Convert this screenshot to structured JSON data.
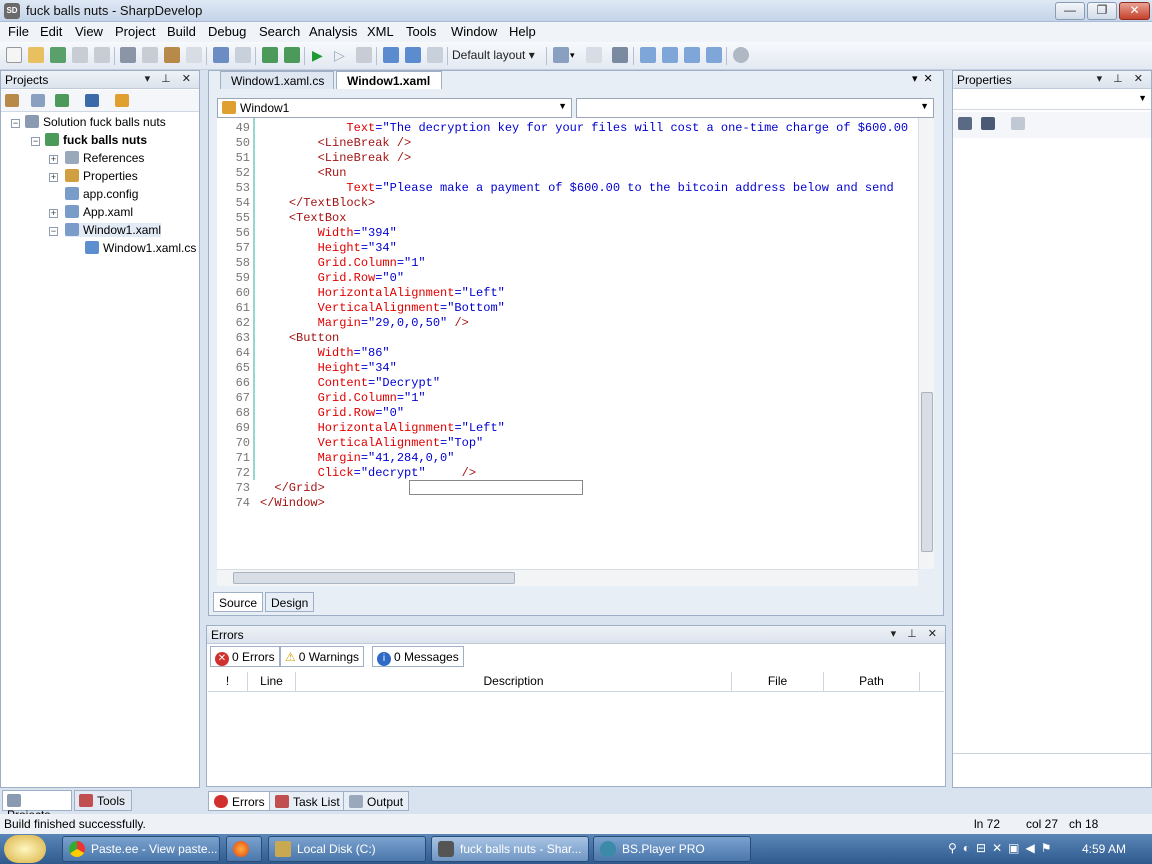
{
  "window": {
    "title": "fuck balls nuts - SharpDevelop",
    "app_icon": "SD"
  },
  "menu": [
    "File",
    "Edit",
    "View",
    "Project",
    "Build",
    "Debug",
    "Search",
    "Analysis",
    "XML",
    "Tools",
    "Window",
    "Help"
  ],
  "toolbar": {
    "layout": "Default layout"
  },
  "projects_panel": {
    "title": "Projects",
    "tree": {
      "solution": "Solution fuck balls nuts",
      "project": "fuck balls nuts",
      "items": [
        "References",
        "Properties",
        "app.config",
        "App.xaml",
        "Window1.xaml"
      ],
      "child": "Window1.xaml.cs"
    },
    "tabs": [
      "Projects",
      "Tools"
    ]
  },
  "editor": {
    "tabs": [
      "Window1.xaml.cs",
      "Window1.xaml"
    ],
    "combo_left": "Window1",
    "combo_right": "",
    "lines": [
      {
        "n": "49",
        "code": "            Text=\"The decryption key for your files will cost a one-time charge of $600.00"
      },
      {
        "n": "50",
        "code": "        <LineBreak />"
      },
      {
        "n": "51",
        "code": "        <LineBreak />"
      },
      {
        "n": "52",
        "code": "        <Run"
      },
      {
        "n": "53",
        "code": "            Text=\"Please make a payment of $600.00 to the bitcoin address below and send"
      },
      {
        "n": "54",
        "code": "    </TextBlock>"
      },
      {
        "n": "55",
        "code": "    <TextBox"
      },
      {
        "n": "56",
        "code": "        Width=\"394\""
      },
      {
        "n": "57",
        "code": "        Height=\"34\""
      },
      {
        "n": "58",
        "code": "        Grid.Column=\"1\""
      },
      {
        "n": "59",
        "code": "        Grid.Row=\"0\""
      },
      {
        "n": "60",
        "code": "        HorizontalAlignment=\"Left\""
      },
      {
        "n": "61",
        "code": "        VerticalAlignment=\"Bottom\""
      },
      {
        "n": "62",
        "code": "        Margin=\"29,0,0,50\" />"
      },
      {
        "n": "63",
        "code": "    <Button"
      },
      {
        "n": "64",
        "code": "        Width=\"86\""
      },
      {
        "n": "65",
        "code": "        Height=\"34\""
      },
      {
        "n": "66",
        "code": "        Content=\"Decrypt\""
      },
      {
        "n": "67",
        "code": "        Grid.Column=\"1\""
      },
      {
        "n": "68",
        "code": "        Grid.Row=\"0\""
      },
      {
        "n": "69",
        "code": "        HorizontalAlignment=\"Left\""
      },
      {
        "n": "70",
        "code": "        VerticalAlignment=\"Top\""
      },
      {
        "n": "71",
        "code": "        Margin=\"41,284,0,0\""
      },
      {
        "n": "72",
        "code": "        Click=\"decrypt\"     />"
      },
      {
        "n": "73",
        "code": "  </Grid>"
      },
      {
        "n": "74",
        "code": "</Window>"
      }
    ],
    "bottom_tabs": [
      "Source",
      "Design"
    ]
  },
  "properties_panel": {
    "title": "Properties"
  },
  "errors_panel": {
    "title": "Errors",
    "buttons": [
      "0 Errors",
      "0 Warnings",
      "0 Messages"
    ],
    "columns": [
      "!",
      "Line",
      "Description",
      "File",
      "Path"
    ],
    "tabs": [
      "Errors",
      "Task List",
      "Output"
    ]
  },
  "status": {
    "message": "Build finished successfully.",
    "line": "ln 72",
    "col": "col 27",
    "ch": "ch 18"
  },
  "taskbar": {
    "tasks": [
      "Paste.ee - View paste...",
      "",
      "Local Disk (C:)",
      "fuck balls nuts - Shar...",
      "BS.Player PRO"
    ],
    "clock": "4:59 AM"
  },
  "colors": {
    "keyword": "#a31515",
    "attribute": "#e00000",
    "value": "#0000d0",
    "accent": "#4b77ab"
  }
}
